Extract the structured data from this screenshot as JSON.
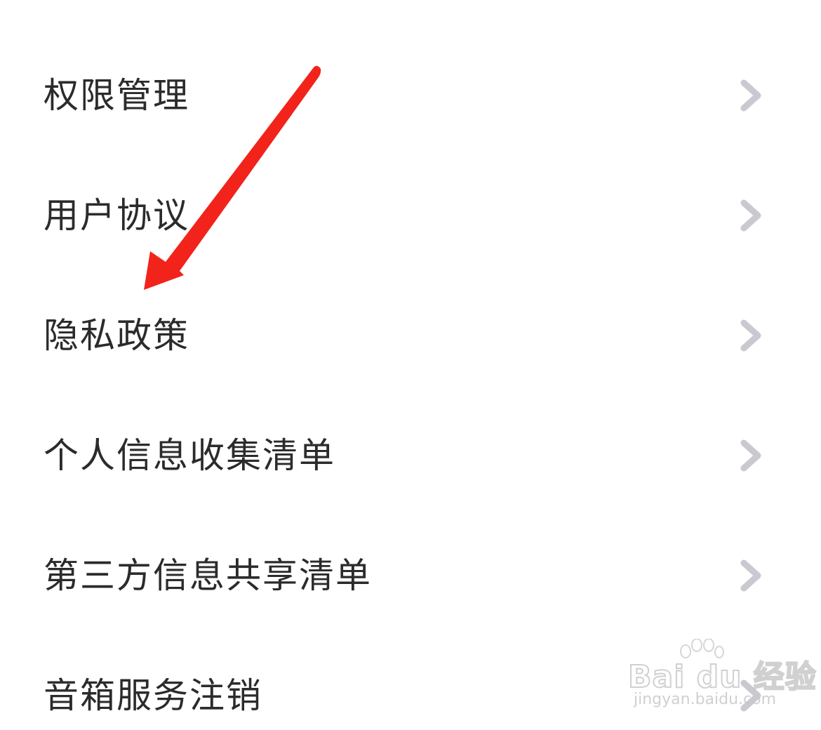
{
  "menu": {
    "items": [
      {
        "label": "权限管理"
      },
      {
        "label": "用户协议"
      },
      {
        "label": "隐私政策"
      },
      {
        "label": "个人信息收集清单"
      },
      {
        "label": "第三方信息共享清单"
      },
      {
        "label": "音箱服务注销"
      }
    ]
  },
  "icons": {
    "chevron": "chevron-right-icon"
  },
  "colors": {
    "text": "#2b2b2b",
    "chevron": "#c9c9d1",
    "annotation_arrow": "#f2231b"
  },
  "watermark": {
    "brand": "Bai du 经验",
    "url": "jingyan.baidu.com"
  }
}
